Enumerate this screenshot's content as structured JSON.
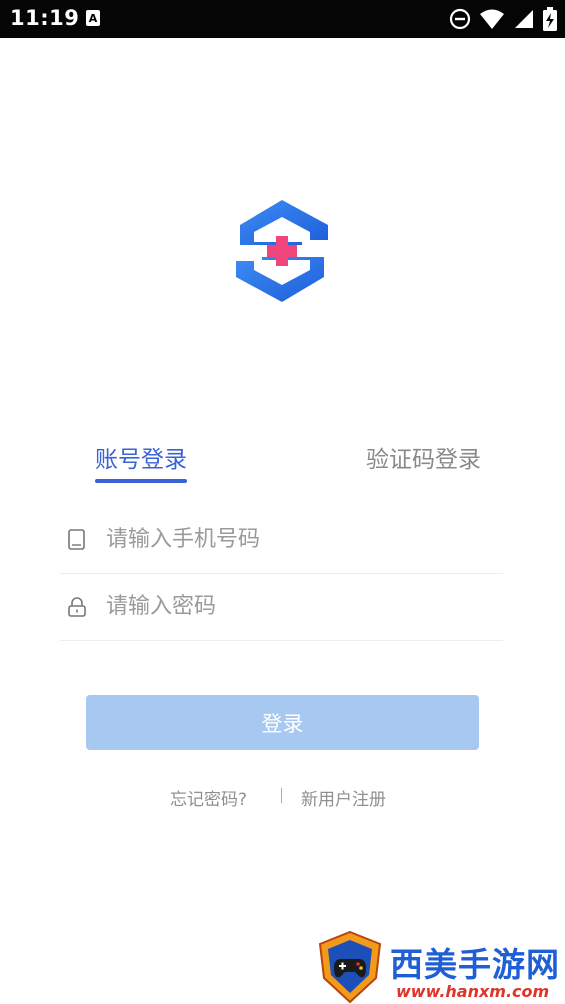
{
  "status_bar": {
    "time": "11:19",
    "notification_icon_letter": "A",
    "icons": [
      "do-not-disturb-icon",
      "wifi-icon",
      "signal-icon",
      "battery-icon"
    ]
  },
  "logo": {
    "icon": "medical-cross-logo-icon",
    "colors": {
      "blue": "#2b6fe6",
      "red": "#f0457a"
    }
  },
  "tabs": [
    {
      "label": "账号登录",
      "active": true
    },
    {
      "label": "验证码登录",
      "active": false
    }
  ],
  "form": {
    "phone": {
      "value": "",
      "placeholder": "请输入手机号码",
      "icon": "phone-icon"
    },
    "password": {
      "value": "",
      "placeholder": "请输入密码",
      "icon": "lock-icon"
    }
  },
  "login_button": {
    "label": "登录"
  },
  "links": {
    "forgot": "忘记密码?",
    "register": "新用户注册"
  },
  "watermark": {
    "title": "西美手游网",
    "url": "www.hanxm.com"
  },
  "colors": {
    "accent": "#3a63d8",
    "button_disabled": "#a7c8f0"
  }
}
